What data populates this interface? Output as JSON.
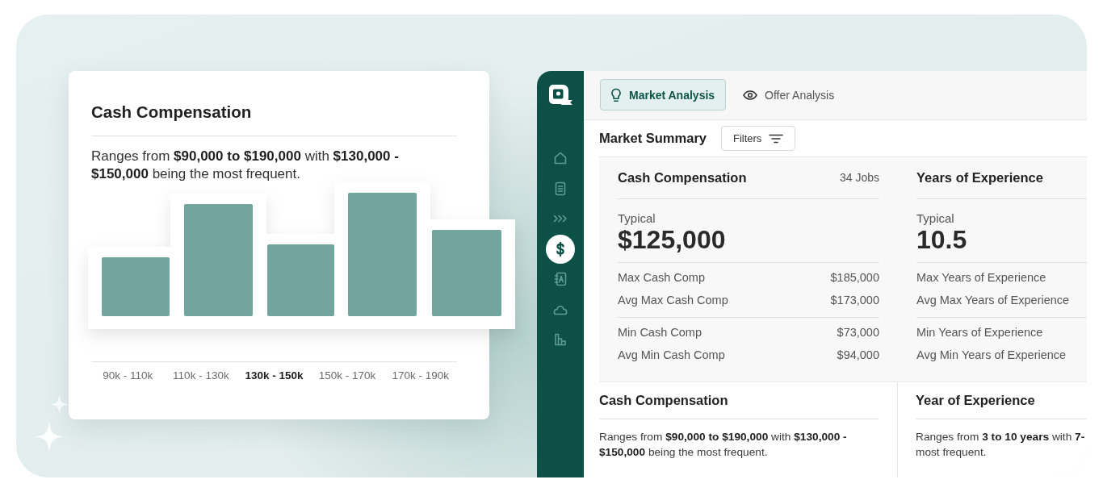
{
  "showcase_card": {
    "title": "Cash Compensation",
    "description": "Ranges from **$90,000 to $190,000** with **$130,000 - $150,000** being the most frequent.",
    "histogram": {
      "bins": [
        {
          "label": "90k - 110k",
          "selected": false
        },
        {
          "label": "110k - 130k",
          "selected": false
        },
        {
          "label": "130k - 150k",
          "selected": true
        },
        {
          "label": "150k - 170k",
          "selected": false
        },
        {
          "label": "170k - 190k",
          "selected": false
        }
      ]
    }
  },
  "app": {
    "sidebar": {
      "items": [
        {
          "selected": false
        },
        {
          "selected": false
        },
        {
          "selected": false
        },
        {
          "selected": true
        },
        {
          "selected": false
        },
        {
          "selected": false
        },
        {
          "selected": false
        }
      ]
    },
    "tabs": [
      {
        "label": "Market Analysis",
        "selected": true
      },
      {
        "label": "Offer Analysis",
        "selected": false
      }
    ],
    "summary": {
      "title": "Market Summary",
      "filters_button": "Filters"
    },
    "stat_columns": [
      {
        "title": "Cash Compensation",
        "count": "34 Jobs",
        "typical_label": "Typical",
        "typical_value": "$125,000",
        "groups": [
          {
            "rows": [
              {
                "label": "Max Cash Comp",
                "value": "$185,000"
              },
              {
                "label": "Avg Max Cash Comp",
                "value": "$173,000"
              }
            ]
          },
          {
            "rows": [
              {
                "label": "Min Cash Comp",
                "value": "$73,000"
              },
              {
                "label": "Avg Min Cash Comp",
                "value": "$94,000"
              }
            ]
          }
        ]
      },
      {
        "title": "Years of Experience",
        "typical_label": "Typical",
        "typical_value": "10.5",
        "groups": [
          {
            "rows": [
              {
                "label": "Max Years of Experience"
              },
              {
                "label": "Avg Max Years of Experience"
              }
            ]
          },
          {
            "rows": [
              {
                "label": "Min Years of Experience"
              },
              {
                "label": "Avg Min Years of Experience"
              }
            ]
          }
        ]
      }
    ],
    "distribution_columns": [
      {
        "title": "Cash Compensation",
        "description": "Ranges from **$90,000 to $190,000** with **$130,000 - $150,000** being the most frequent."
      },
      {
        "title": "Year of Experience",
        "description": "Ranges from **3 to 10 years** with **7-**\nmost frequent."
      }
    ]
  }
}
